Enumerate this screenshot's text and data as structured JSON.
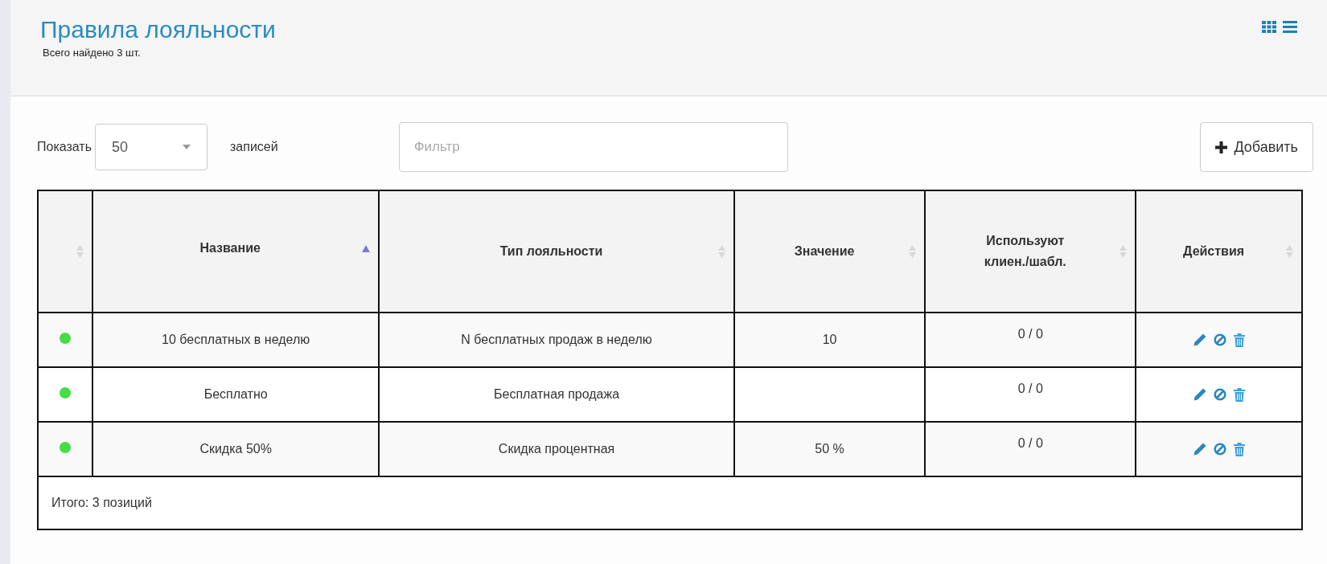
{
  "header": {
    "title": "Правила лояльности",
    "subtitle": "Всего найдено 3 шт.",
    "view_modes": [
      {
        "kind": "grid"
      },
      {
        "kind": "list"
      }
    ]
  },
  "toolbar": {
    "show_label": "Показать",
    "page_size": "50",
    "records_label": "записей",
    "filter": {
      "placeholder": "Фильтр"
    },
    "add_button": "Добавить"
  },
  "table": {
    "columns": [
      {
        "sorted": false
      },
      {
        "label": "Название",
        "sorted": true
      },
      {
        "label": "Тип лояльности",
        "sorted": false
      },
      {
        "label": "Значение",
        "sorted": false
      },
      {
        "label": "Используют клиен./шабл.",
        "sorted": false
      },
      {
        "label": "Действия",
        "sorted": false
      }
    ],
    "rows": [
      {
        "color": "#44dd44",
        "name": "10 бесплатных в неделю",
        "type": "N бесплатных продаж в неделю",
        "value": "10",
        "usage": "0 / 0"
      },
      {
        "color": "#44dd44",
        "name": "Бесплатно",
        "type": "Бесплатная продажа",
        "usage": "0 / 0"
      },
      {
        "color": "#44dd44",
        "name": "Скидка 50%",
        "type": "Скидка процентная",
        "value": "50 %",
        "usage": "0 / 0"
      }
    ],
    "footer": "Итого: 3 позиций"
  }
}
